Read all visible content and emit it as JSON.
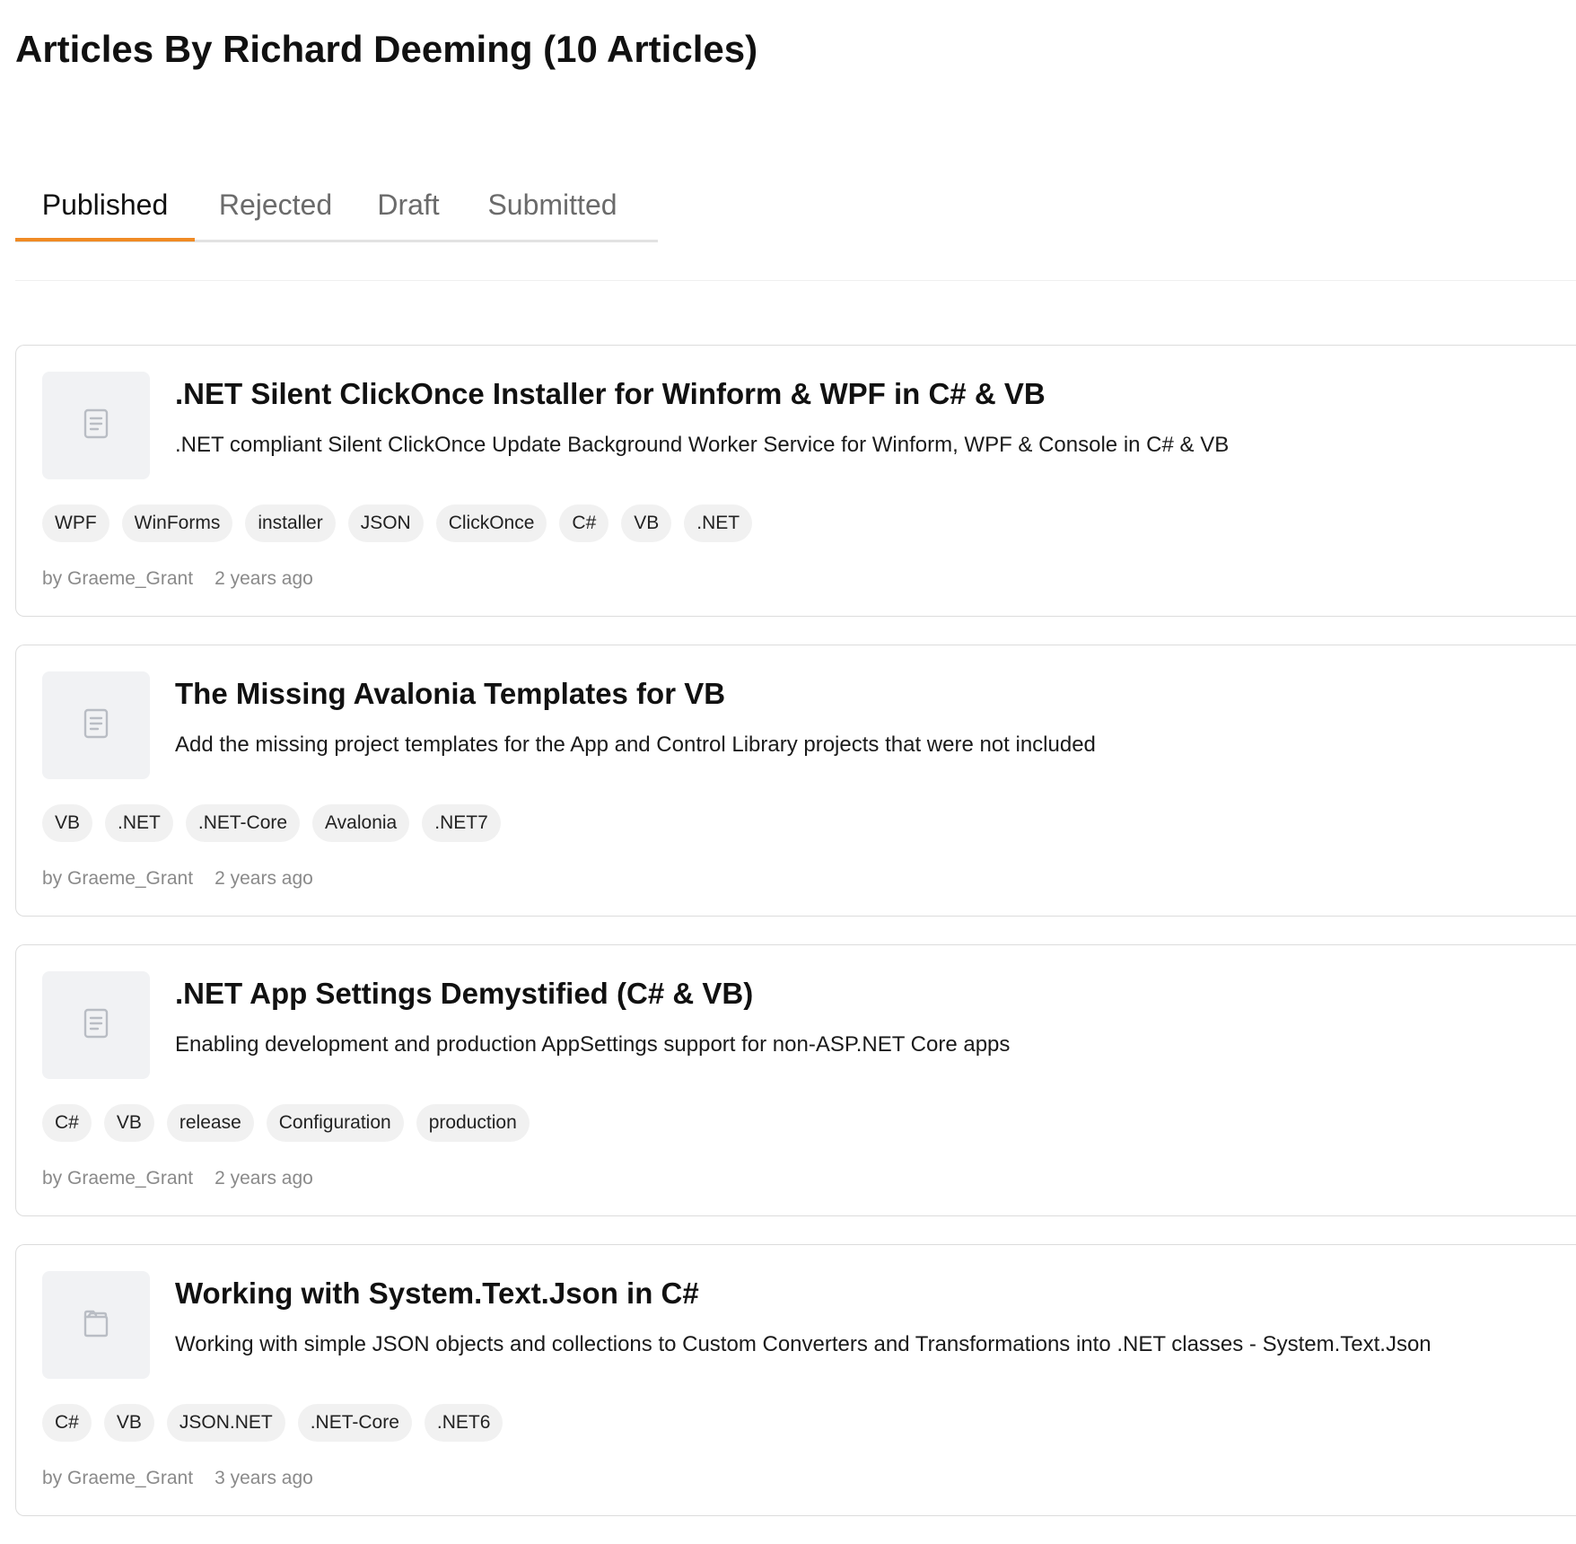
{
  "page": {
    "title": "Articles By Richard Deeming (10 Articles)"
  },
  "tabs": [
    {
      "label": "Published",
      "active": true
    },
    {
      "label": "Rejected",
      "active": false
    },
    {
      "label": "Draft",
      "active": false
    },
    {
      "label": "Submitted",
      "active": false
    }
  ],
  "colors": {
    "accent": "#f08a24",
    "tag_bg": "#f1f1f1",
    "thumb_bg": "#f1f2f4",
    "meta_text": "#8a8a8a"
  },
  "articles": [
    {
      "title": ".NET Silent ClickOnce Installer for Winform & WPF in C# & VB",
      "description": ".NET compliant Silent ClickOnce Update Background Worker Service for Winform, WPF & Console in C# & VB",
      "icon": "document-icon",
      "tags": [
        "WPF",
        "WinForms",
        "installer",
        "JSON",
        "ClickOnce",
        "C#",
        "VB",
        ".NET"
      ],
      "author": "by Graeme_Grant",
      "time": "2 years ago"
    },
    {
      "title": "The Missing Avalonia Templates for VB",
      "description": "Add the missing project templates for the App and Control Library projects that were not included",
      "icon": "document-icon",
      "tags": [
        "VB",
        ".NET",
        ".NET-Core",
        "Avalonia",
        ".NET7"
      ],
      "author": "by Graeme_Grant",
      "time": "2 years ago"
    },
    {
      "title": ".NET App Settings Demystified (C# & VB)",
      "description": "Enabling development and production AppSettings support for non-ASP.NET Core apps",
      "icon": "document-icon",
      "tags": [
        "C#",
        "VB",
        "release",
        "Configuration",
        "production"
      ],
      "author": "by Graeme_Grant",
      "time": "2 years ago"
    },
    {
      "title": "Working with System.Text.Json in C#",
      "description": "Working with simple JSON objects and collections to Custom Converters and Transformations into .NET classes - System.Text.Json",
      "icon": "folder-icon",
      "tags": [
        "C#",
        "VB",
        "JSON.NET",
        ".NET-Core",
        ".NET6"
      ],
      "author": "by Graeme_Grant",
      "time": "3 years ago"
    }
  ]
}
